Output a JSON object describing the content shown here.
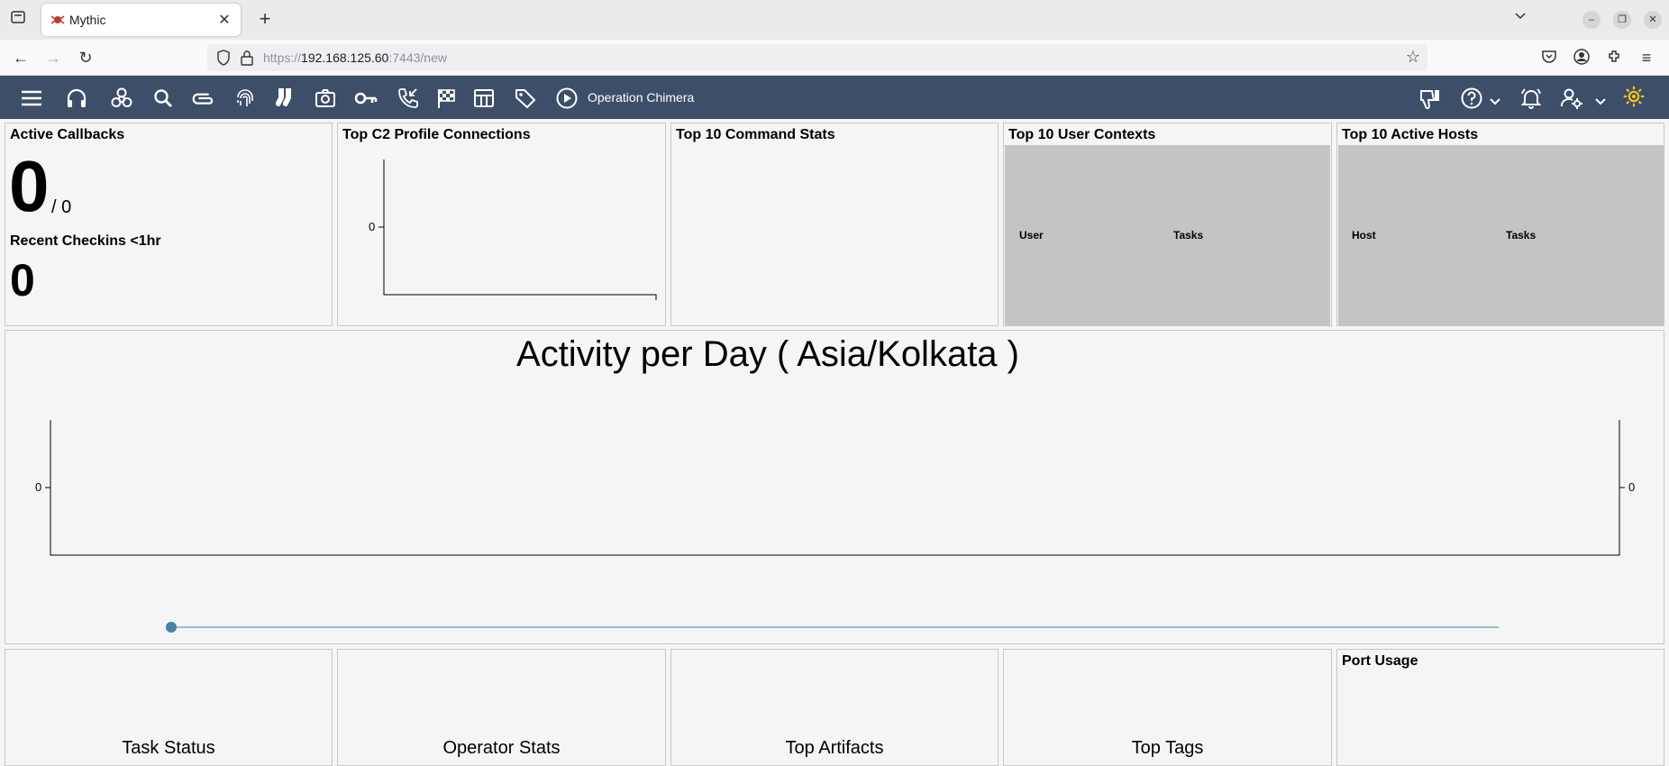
{
  "browser": {
    "tab_title": "Mythic",
    "url_prefix": "https://",
    "url_host": "192.168.125.60",
    "url_suffix": ":7443/new"
  },
  "app": {
    "operation_name": "Operation Chimera",
    "accent_color": "#3d4f68",
    "nav_icons": [
      "menu-icon",
      "headphones-icon",
      "biohazard-icon",
      "search-icon",
      "paperclip-icon",
      "fingerprint-icon",
      "socks-icon",
      "camera-icon",
      "key-icon",
      "phone-callback-icon",
      "checkered-flag-icon",
      "table-icon",
      "tag-icon",
      "play-circle-icon"
    ],
    "right_icons": [
      "thumbs-down-icon",
      "help-icon",
      "bell-icon",
      "user-settings-icon",
      "sun-icon"
    ]
  },
  "dashboard": {
    "active_callbacks": {
      "title": "Active Callbacks",
      "count": "0",
      "total": "/ 0",
      "recent_title": "Recent Checkins <1hr",
      "recent_count": "0"
    },
    "c2_profiles": {
      "title": "Top C2 Profile Connections",
      "y_tick": "0"
    },
    "command_stats": {
      "title": "Top 10 Command Stats"
    },
    "user_contexts": {
      "title": "Top 10 User Contexts",
      "col1": "User",
      "col2": "Tasks"
    },
    "active_hosts": {
      "title": "Top 10 Active Hosts",
      "col1": "Host",
      "col2": "Tasks"
    },
    "activity": {
      "title": "Activity per Day ( Asia/Kolkata )",
      "left_tick": "0",
      "right_tick": "0"
    },
    "bottom": {
      "task_status": "Task Status",
      "operator_stats": "Operator Stats",
      "top_artifacts": "Top Artifacts",
      "top_tags": "Top Tags",
      "port_usage": "Port Usage"
    }
  }
}
